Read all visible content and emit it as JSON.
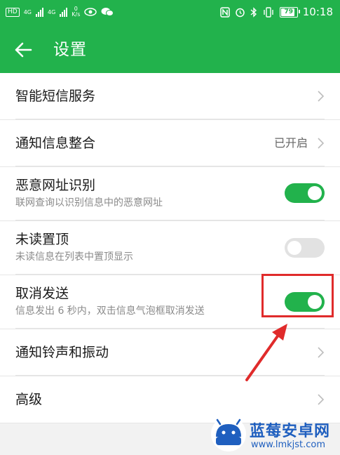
{
  "status_bar": {
    "hd": "HD",
    "net1": "4G",
    "net2": "4G",
    "speed_value": "0",
    "speed_unit": "K/s",
    "battery": "79",
    "time": "10:18"
  },
  "app_bar": {
    "title": "设置"
  },
  "settings": {
    "smart_sms": {
      "title": "智能短信服务"
    },
    "notify_merge": {
      "title": "通知信息整合",
      "value": "已开启"
    },
    "malicious_url": {
      "title": "恶意网址识别",
      "subtitle": "联网查询以识别信息中的恶意网址",
      "enabled": true
    },
    "unread_top": {
      "title": "未读置顶",
      "subtitle": "未读信息在列表中置顶显示",
      "enabled": false
    },
    "cancel_send": {
      "title": "取消发送",
      "subtitle": "信息发出 6 秒内，双击信息气泡框取消发送",
      "enabled": true
    },
    "ringtone_vibration": {
      "title": "通知铃声和振动"
    },
    "advanced": {
      "title": "高级"
    }
  },
  "watermark": {
    "brand": "蓝莓安卓网",
    "url": "www.lmkjst.com"
  },
  "colors": {
    "accent": "#22b24c",
    "annotation": "#e02b2b",
    "watermark": "#1f5fbf"
  }
}
